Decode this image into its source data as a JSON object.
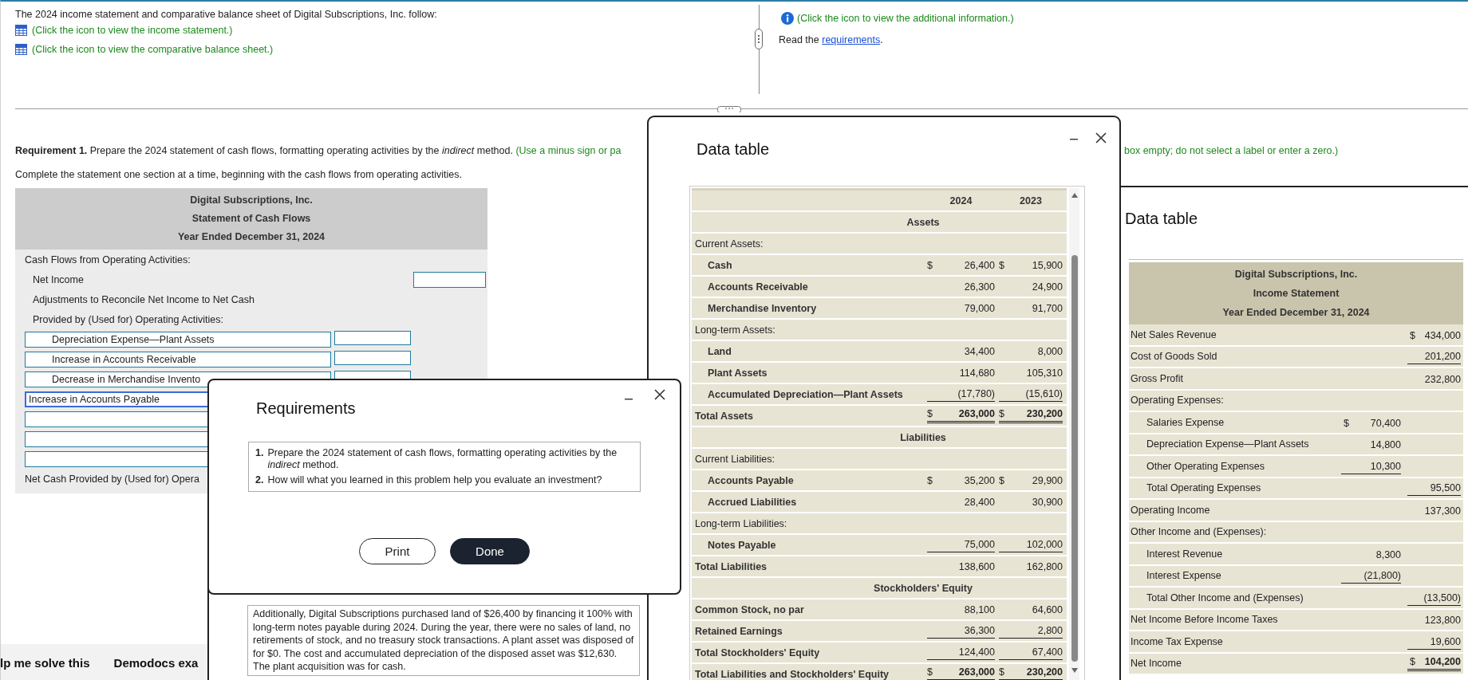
{
  "page": {
    "intro": "The 2024 income statement and comparative balance sheet of Digital Subscriptions, Inc. follow:",
    "links": [
      "(Click the icon to view the income statement.)",
      "(Click the icon to view the comparative balance sheet.)"
    ],
    "info_link": "(Click the icon to view the additional information.)",
    "read_prefix": "Read the",
    "read_link": "requirements",
    "read_suffix": "."
  },
  "requirement": {
    "lead": "**Requirement 1.** Prepare the 2024 statement of cash flows, formatting operating activities by the *indirect* method.",
    "hint": "(Use a minus sign or pa",
    "hint_rest": "box empty; do not select a label or enter a zero.)",
    "instruction": "Complete the statement one section at a time, beginning with the cash flows from operating activities."
  },
  "cash_flow": {
    "title_lines": [
      "Digital Subscriptions, Inc.",
      "Statement of Cash Flows",
      "Year Ended December 31, 2024"
    ],
    "rows": [
      {
        "kind": "heading",
        "label": "Cash Flows from Operating Activities:"
      },
      {
        "kind": "line",
        "label": "Net Income"
      },
      {
        "kind": "text",
        "label": "Adjustments to Reconcile Net Income to Net Cash"
      },
      {
        "kind": "text",
        "label": "Provided by (Used for) Operating Activities:"
      },
      {
        "kind": "entry",
        "value": "Depreciation Expense—Plant Assets",
        "amount_field": true,
        "focused": false
      },
      {
        "kind": "entry",
        "value": "Increase in Accounts Receivable",
        "amount_field": true,
        "focused": false
      },
      {
        "kind": "entry",
        "value": "Decrease in Merchandise Invento",
        "amount_field": true,
        "focused": false
      },
      {
        "kind": "entry",
        "value": "Increase in Accounts Payable",
        "amount_field": false,
        "focused": true
      },
      {
        "kind": "blank",
        "amount_field": false,
        "focused": false
      },
      {
        "kind": "blank",
        "amount_field": false,
        "focused": false
      },
      {
        "kind": "blank",
        "amount_field": false,
        "focused": false
      },
      {
        "kind": "heading",
        "label": "Net Cash Provided by (Used for) Opera"
      }
    ]
  },
  "bottom_bar": [
    "lp me solve this",
    "Demodocs exa"
  ],
  "additional": {
    "text": "Additionally, Digital Subscriptions purchased land of $26,400 by financing it 100% with long-term notes payable during 2024. During the year, there were no sales of land, no retirements of stock, and no treasury stock transactions. A plant asset was disposed of for $0. The cost and accumulated depreciation of the disposed asset was $12,630. The plant acquisition was for cash."
  },
  "balance": {
    "title": "Data table",
    "years": [
      "2024",
      "2023"
    ],
    "rows": [
      {
        "kind": "section",
        "label": "Assets"
      },
      {
        "kind": "group",
        "label": "Current Assets:"
      },
      {
        "kind": "item",
        "label": "Cash",
        "cells": [
          {
            "sign": "$",
            "value": "26,400"
          },
          {
            "sign": "$",
            "value": "15,900"
          }
        ]
      },
      {
        "kind": "item",
        "label": "Accounts Receivable",
        "cells": [
          {
            "value": "26,300"
          },
          {
            "value": "24,900"
          }
        ]
      },
      {
        "kind": "item",
        "label": "Merchandise Inventory",
        "cells": [
          {
            "value": "79,000"
          },
          {
            "value": "91,700"
          }
        ]
      },
      {
        "kind": "group",
        "label": "Long-term Assets:"
      },
      {
        "kind": "item",
        "label": "Land",
        "cells": [
          {
            "value": "34,400"
          },
          {
            "value": "8,000"
          }
        ]
      },
      {
        "kind": "item",
        "label": "Plant Assets",
        "cells": [
          {
            "value": "114,680"
          },
          {
            "value": "105,310"
          }
        ]
      },
      {
        "kind": "item",
        "label": "Accumulated Depreciation—Plant Assets",
        "cells": [
          {
            "value": "(17,780)"
          },
          {
            "value": "(15,610)"
          }
        ],
        "underlined": true
      },
      {
        "kind": "grand",
        "label": "Total Assets",
        "cells": [
          {
            "sign": "$",
            "value": "263,000"
          },
          {
            "sign": "$",
            "value": "230,200"
          }
        ],
        "double_underlined": true
      },
      {
        "kind": "section",
        "label": "Liabilities"
      },
      {
        "kind": "group",
        "label": "Current Liabilities:"
      },
      {
        "kind": "item",
        "label": "Accounts Payable",
        "cells": [
          {
            "sign": "$",
            "value": "35,200"
          },
          {
            "sign": "$",
            "value": "29,900"
          }
        ]
      },
      {
        "kind": "item",
        "label": "Accrued Liabilities",
        "cells": [
          {
            "value": "28,400"
          },
          {
            "value": "30,900"
          }
        ]
      },
      {
        "kind": "group",
        "label": "Long-term Liabilities:"
      },
      {
        "kind": "item",
        "label": "Notes Payable",
        "cells": [
          {
            "value": "75,000"
          },
          {
            "value": "102,000"
          }
        ],
        "underlined": true
      },
      {
        "kind": "total",
        "label": "Total Liabilities",
        "cells": [
          {
            "value": "138,600"
          },
          {
            "value": "162,800"
          }
        ]
      },
      {
        "kind": "section",
        "label": "Stockholders' Equity"
      },
      {
        "kind": "total",
        "label": "Common Stock, no par",
        "cells": [
          {
            "value": "88,100"
          },
          {
            "value": "64,600"
          }
        ]
      },
      {
        "kind": "total",
        "label": "Retained Earnings",
        "cells": [
          {
            "value": "36,300"
          },
          {
            "value": "2,800"
          }
        ],
        "underlined": true
      },
      {
        "kind": "total",
        "label": "Total Stockholders' Equity",
        "cells": [
          {
            "value": "124,400"
          },
          {
            "value": "67,400"
          }
        ],
        "underlined": true
      },
      {
        "kind": "grand",
        "label": "Total Liabilities and Stockholders' Equity",
        "cells": [
          {
            "sign": "$",
            "value": "263,000"
          },
          {
            "sign": "$",
            "value": "230,200"
          }
        ],
        "double_underlined": true
      }
    ]
  },
  "income": {
    "title": "Data table",
    "heading": [
      "Digital Subscriptions, Inc.",
      "Income Statement",
      "Year Ended December 31, 2024"
    ],
    "rows": [
      {
        "kind": "main",
        "label": "Net Sales Revenue",
        "outer": {
          "sign": "$",
          "value": "434,000"
        }
      },
      {
        "kind": "main",
        "label": "Cost of Goods Sold",
        "outer": {
          "value": "201,200"
        },
        "underlined": true
      },
      {
        "kind": "main",
        "label": "Gross Profit",
        "outer": {
          "value": "232,800"
        }
      },
      {
        "kind": "main",
        "label": "Operating Expenses:"
      },
      {
        "kind": "sub",
        "label": "Salaries Expense",
        "inner": {
          "sign": "$",
          "value": "70,400"
        }
      },
      {
        "kind": "sub",
        "label": "Depreciation Expense—Plant Assets",
        "inner": {
          "value": "14,800"
        }
      },
      {
        "kind": "sub",
        "label": "Other Operating Expenses",
        "inner": {
          "value": "10,300"
        },
        "underlined": true
      },
      {
        "kind": "sub",
        "label": "Total Operating Expenses",
        "outer": {
          "value": "95,500"
        },
        "underlined": true
      },
      {
        "kind": "main",
        "label": "Operating Income",
        "outer": {
          "value": "137,300"
        }
      },
      {
        "kind": "main",
        "label": "Other Income and (Expenses):"
      },
      {
        "kind": "sub",
        "label": "Interest Revenue",
        "inner": {
          "value": "8,300"
        }
      },
      {
        "kind": "sub",
        "label": "Interest Expense",
        "inner": {
          "value": "(21,800)"
        },
        "underlined": true
      },
      {
        "kind": "sub",
        "label": "Total Other Income and (Expenses)",
        "outer": {
          "value": "(13,500)"
        },
        "underlined": true
      },
      {
        "kind": "main",
        "label": "Net Income Before Income Taxes",
        "outer": {
          "value": "123,800"
        }
      },
      {
        "kind": "main",
        "label": "Income Tax Expense",
        "outer": {
          "value": "19,600"
        },
        "underlined": true
      },
      {
        "kind": "net",
        "label": "Net Income",
        "outer": {
          "sign": "$",
          "value": "104,200"
        },
        "double_underlined": true
      }
    ]
  },
  "requirements": {
    "title": "Requirements",
    "items": [
      {
        "number": "1.",
        "text": "Prepare the 2024 statement of cash flows, formatting operating activities by the *indirect* method."
      },
      {
        "number": "2.",
        "text": "How will what you learned in this problem help you evaluate an investment?"
      }
    ],
    "buttons": [
      {
        "label": "Print",
        "kind": "secondary"
      },
      {
        "label": "Done",
        "kind": "primary"
      }
    ]
  }
}
